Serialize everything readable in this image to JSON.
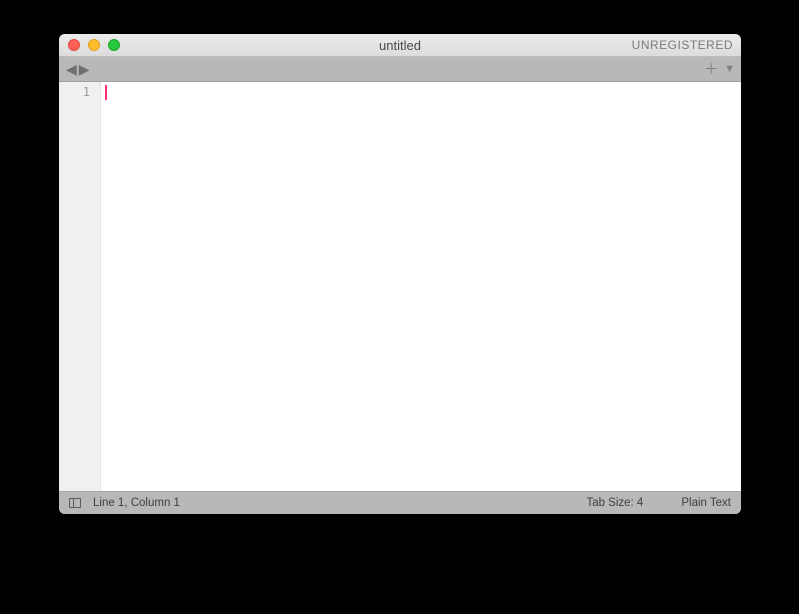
{
  "titlebar": {
    "title": "untitled",
    "registration": "UNREGISTERED"
  },
  "gutter": {
    "line1": "1"
  },
  "statusbar": {
    "position": "Line 1, Column 1",
    "tab_size": "Tab Size: 4",
    "syntax": "Plain Text"
  }
}
